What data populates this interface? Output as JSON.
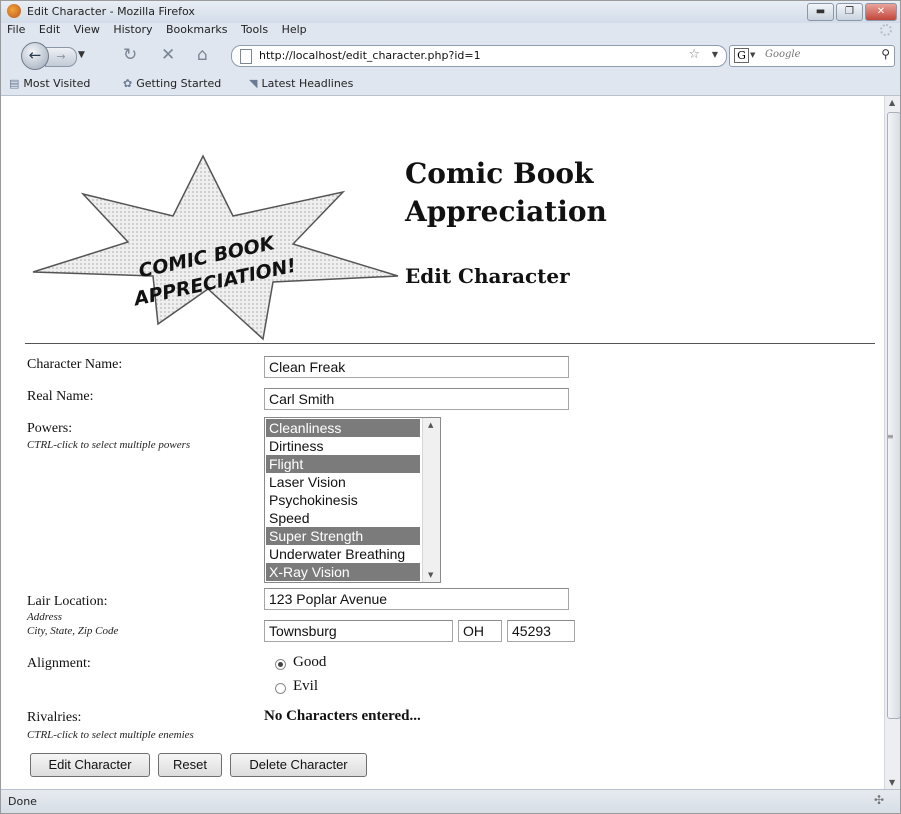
{
  "window": {
    "title": "Edit Character - Mozilla Firefox",
    "controls": [
      "▬",
      "❐",
      "✕"
    ]
  },
  "menu": [
    "File",
    "Edit",
    "View",
    "History",
    "Bookmarks",
    "Tools",
    "Help"
  ],
  "nav": {
    "url": "http://localhost/edit_character.php?id=1",
    "search_placeholder": "Google",
    "search_engine_letter": "G"
  },
  "bookmarks": [
    "Most Visited",
    "Getting Started",
    "Latest Headlines"
  ],
  "page": {
    "logo_line1": "COMIC BOOK",
    "logo_line2": "APPRECIATION!",
    "title": "Comic Book Appreciation",
    "subtitle": "Edit Character"
  },
  "form": {
    "character_name_label": "Character Name:",
    "character_name_value": "Clean Freak",
    "real_name_label": "Real Name:",
    "real_name_value": "Carl Smith",
    "powers_label": "Powers:",
    "powers_hint": "CTRL-click to select multiple powers",
    "powers": [
      {
        "label": "Cleanliness",
        "selected": true
      },
      {
        "label": "Dirtiness",
        "selected": false
      },
      {
        "label": "Flight",
        "selected": true
      },
      {
        "label": "Laser Vision",
        "selected": false
      },
      {
        "label": "Psychokinesis",
        "selected": false
      },
      {
        "label": "Speed",
        "selected": false
      },
      {
        "label": "Super Strength",
        "selected": true
      },
      {
        "label": "Underwater Breathing",
        "selected": false
      },
      {
        "label": "X-Ray Vision",
        "selected": true
      }
    ],
    "lair_label": "Lair Location:",
    "lair_hint_1": "Address",
    "lair_hint_2": "City, State, Zip Code",
    "address_value": "123 Poplar Avenue",
    "city_value": "Townsburg",
    "state_value": "OH",
    "zip_value": "45293",
    "alignment_label": "Alignment:",
    "alignment_options": [
      {
        "label": "Good",
        "checked": true
      },
      {
        "label": "Evil",
        "checked": false
      }
    ],
    "rivalries_label": "Rivalries:",
    "rivalries_hint": "CTRL-click to select multiple enemies",
    "rivalries_value": "No Characters entered...",
    "buttons": {
      "edit": "Edit Character",
      "reset": "Reset",
      "delete": "Delete Character"
    }
  },
  "status": "Done",
  "icons": {
    "back": "back-arrow-icon",
    "forward": "forward-arrow-icon",
    "reload": "reload-icon",
    "stop": "stop-icon",
    "home": "home-icon",
    "star": "star-icon",
    "search": "magnifier-icon"
  }
}
